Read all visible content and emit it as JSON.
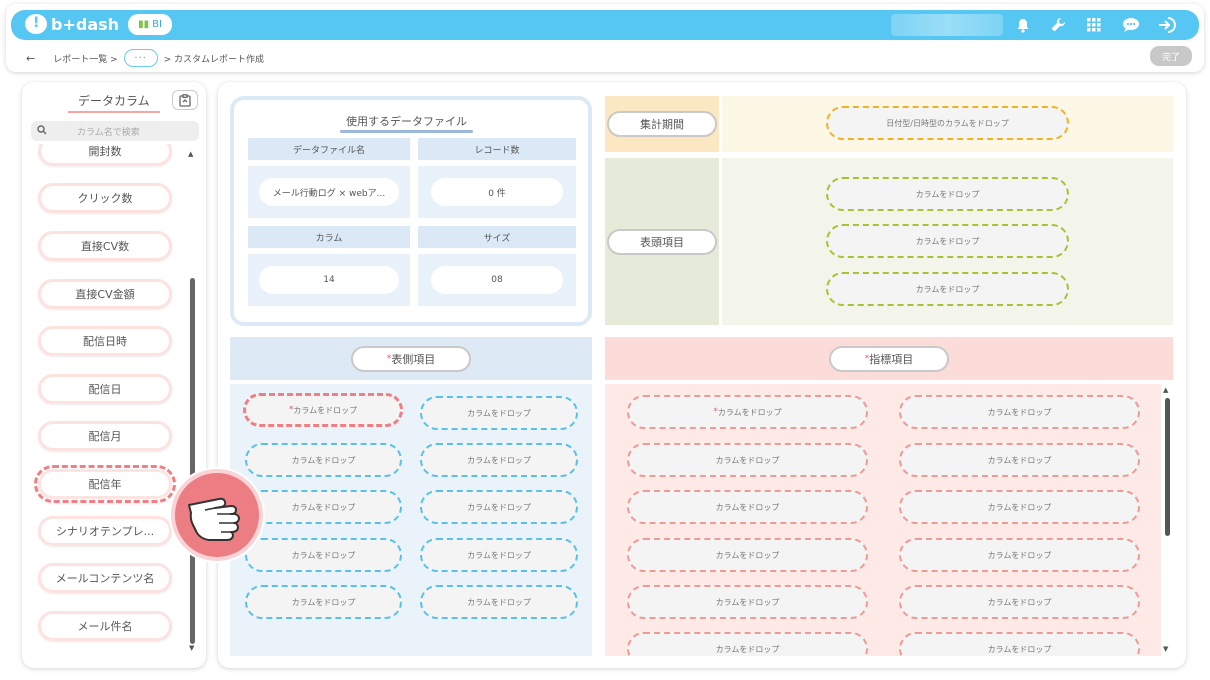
{
  "app": {
    "logo_text": "b+dash",
    "badge": "BI",
    "accent": "#56c7f2"
  },
  "header_icons": [
    "bell-icon",
    "wrench-icon",
    "grid-icon",
    "chat-icon",
    "logout-icon"
  ],
  "breadcrumb": {
    "back": "←",
    "item1": "レポート一覧 >",
    "more": "···",
    "item2": "> カスタムレポート作成"
  },
  "done_button": "完了",
  "left_panel": {
    "title": "データカラム",
    "search_placeholder": "カラム名で検索",
    "columns": [
      "開封数",
      "クリック数",
      "直接CV数",
      "直接CV金額",
      "配信日時",
      "配信日",
      "配信月",
      "配信年",
      "シナリオテンプレ...",
      "メールコンテンツ名",
      "メール件名"
    ],
    "selected": "配信年"
  },
  "file_box": {
    "title": "使用するデータファイル",
    "headers": [
      "データファイル名",
      "レコード数",
      "カラム",
      "サイズ"
    ],
    "values": [
      "メール行動ログ × webア...",
      "0 件",
      "14",
      "08"
    ]
  },
  "period": {
    "label": "集計期間",
    "drop": "日付型/日時型のカラムをドロップ"
  },
  "header_items": {
    "label": "表頭項目",
    "drops": [
      "カラムをドロップ",
      "カラムをドロップ",
      "カラムをドロップ"
    ]
  },
  "row_side": {
    "required": "*",
    "label": "表側項目",
    "first_drop": "カラムをドロップ",
    "drop": "カラムをドロップ"
  },
  "metrics": {
    "required": "*",
    "label": "指標項目",
    "first_drop": "カラムをドロップ",
    "drop": "カラムをドロップ"
  }
}
